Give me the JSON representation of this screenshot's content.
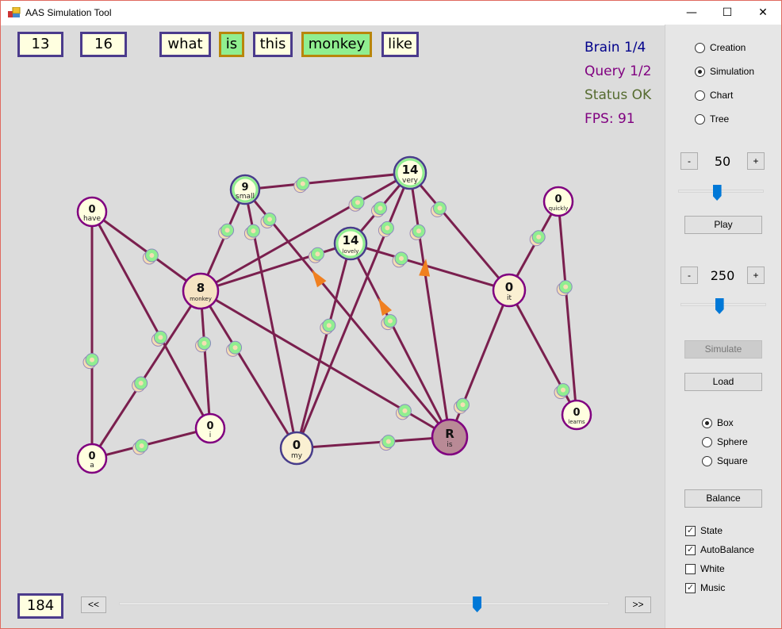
{
  "window": {
    "title": "AAS Simulation Tool",
    "minimize": "—",
    "maximize": "☐",
    "close": "✕"
  },
  "top_counters": [
    "13",
    "16"
  ],
  "query_words": [
    {
      "text": "what",
      "highlight": false
    },
    {
      "text": "is",
      "highlight": true
    },
    {
      "text": "this",
      "highlight": false
    },
    {
      "text": "monkey",
      "highlight": true
    },
    {
      "text": "like",
      "highlight": false
    }
  ],
  "status": {
    "brain": "Brain 1/4",
    "query": "Query 1/2",
    "status": "Status OK",
    "fps": "FPS: 91"
  },
  "colors": {
    "edge": "#7a1f4e",
    "node_border": "#800080",
    "node_border_active": "#483d8b",
    "active_ring": "#90ee90",
    "node_fill": "#ffffe0",
    "monkey_fill": "#f5e3c3",
    "root_fill": "#b98a96",
    "packet": "#90ee90",
    "packet_shadow": "#f5deb3",
    "arrow": "#f08020"
  },
  "graph": {
    "nodes": [
      {
        "id": "have",
        "value": "0",
        "label": "have",
        "state": "idle"
      },
      {
        "id": "small",
        "value": "9",
        "label": "small",
        "state": "active"
      },
      {
        "id": "very",
        "value": "14",
        "label": "very",
        "state": "active"
      },
      {
        "id": "lovely",
        "value": "14",
        "label": "lovely",
        "state": "active"
      },
      {
        "id": "monkey",
        "value": "8",
        "label": "monkey",
        "state": "warm"
      },
      {
        "id": "quickly",
        "value": "0",
        "label": "quickly",
        "state": "idle"
      },
      {
        "id": "it",
        "value": "0",
        "label": "it",
        "state": "warm"
      },
      {
        "id": "a",
        "value": "0",
        "label": "a",
        "state": "idle"
      },
      {
        "id": "i",
        "value": "0",
        "label": "i",
        "state": "idle"
      },
      {
        "id": "my",
        "value": "0",
        "label": "my",
        "state": "query"
      },
      {
        "id": "is",
        "value": "R",
        "label": "is",
        "state": "root"
      },
      {
        "id": "learns",
        "value": "0",
        "label": "learns",
        "state": "idle"
      }
    ],
    "edges": [
      [
        "have",
        "a"
      ],
      [
        "have",
        "i"
      ],
      [
        "have",
        "monkey"
      ],
      [
        "small",
        "very"
      ],
      [
        "small",
        "monkey"
      ],
      [
        "small",
        "my"
      ],
      [
        "small",
        "is"
      ],
      [
        "very",
        "monkey"
      ],
      [
        "very",
        "lovely"
      ],
      [
        "very",
        "my"
      ],
      [
        "very",
        "is"
      ],
      [
        "very",
        "it"
      ],
      [
        "lovely",
        "monkey"
      ],
      [
        "lovely",
        "it"
      ],
      [
        "lovely",
        "my"
      ],
      [
        "lovely",
        "is"
      ],
      [
        "monkey",
        "a"
      ],
      [
        "monkey",
        "i"
      ],
      [
        "monkey",
        "my"
      ],
      [
        "monkey",
        "is"
      ],
      [
        "it",
        "quickly"
      ],
      [
        "it",
        "is"
      ],
      [
        "quickly",
        "learns"
      ],
      [
        "learns",
        "it"
      ],
      [
        "a",
        "i"
      ],
      [
        "my",
        "is"
      ]
    ]
  },
  "side": {
    "modes": [
      {
        "label": "Creation",
        "checked": false
      },
      {
        "label": "Simulation",
        "checked": true
      },
      {
        "label": "Chart",
        "checked": false
      },
      {
        "label": "Tree",
        "checked": false
      }
    ],
    "speed": {
      "minus": "-",
      "value": "50",
      "plus": "+",
      "slider_fraction": 0.45
    },
    "play": "Play",
    "steps": {
      "minus": "-",
      "value": "250",
      "plus": "+",
      "slider_fraction": 0.45
    },
    "simulate": "Simulate",
    "load": "Load",
    "shapes": [
      {
        "label": "Box",
        "checked": true
      },
      {
        "label": "Sphere",
        "checked": false
      },
      {
        "label": "Square",
        "checked": false
      }
    ],
    "balance": "Balance",
    "options": [
      {
        "label": "State",
        "checked": true
      },
      {
        "label": "AutoBalance",
        "checked": true
      },
      {
        "label": "White",
        "checked": false
      },
      {
        "label": "Music",
        "checked": true
      }
    ]
  },
  "bottom": {
    "frame": "184",
    "prev": "<<",
    "next": ">>",
    "timeline_fraction": 0.73
  }
}
